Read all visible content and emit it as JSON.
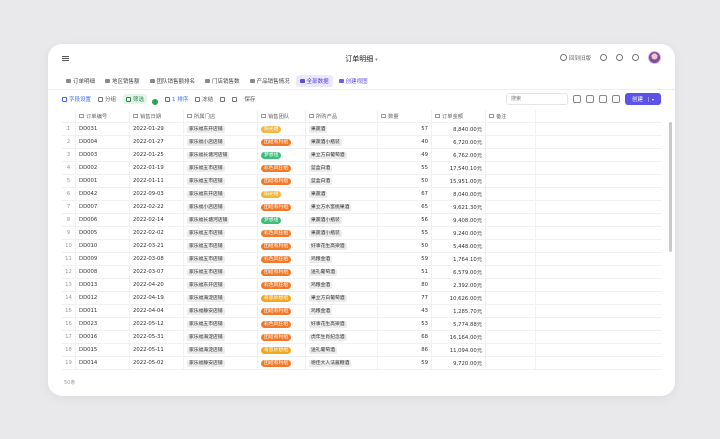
{
  "app": {
    "title": "订单明细"
  },
  "top_actions": {
    "reply_label": "回到旧版"
  },
  "tabs": [
    {
      "label": "订单明细"
    },
    {
      "label": "地区销售额"
    },
    {
      "label": "团队销售额排名"
    },
    {
      "label": "门店销售数"
    },
    {
      "label": "产品销售情况"
    },
    {
      "label": "全部数据",
      "active": true
    },
    {
      "label": "创建视图",
      "purple": true
    }
  ],
  "toolbar": {
    "fields": "字段设置",
    "group": "分组",
    "filter": "筛选",
    "sort": "1 排序",
    "fill": "冻结",
    "save": "保存",
    "search_placeholder": "搜索",
    "create": "创建"
  },
  "columns": [
    "订单编号",
    "销售日期",
    "所属门店",
    "销售团队",
    "所购产品",
    "数量",
    "订单金额",
    "备注"
  ],
  "colors": {
    "团结有利观": "#f07a2c",
    "阳光組": "#f3b63a",
    "梦想组": "#3ebd79",
    "彩色风狂组": "#ef9b3a",
    "奇思妙想组": "#f2b21e"
  },
  "rows": [
    {
      "idx": "1",
      "id": "DD031",
      "date": "2022-01-29",
      "store": "家乐福东开店铺",
      "team": "阳光组",
      "team_color": "#f3b63a",
      "product": "果蔬酒",
      "qty": "57",
      "amount": "8,840.00元"
    },
    {
      "idx": "2",
      "id": "DD004",
      "date": "2022-01-27",
      "store": "家乐福小店店铺",
      "team": "团结有利组",
      "team_color": "#f07a2c",
      "product": "果蔬酒小瓶装",
      "qty": "40",
      "amount": "6,720.00元"
    },
    {
      "idx": "3",
      "id": "DD003",
      "date": "2022-01-25",
      "store": "家乐福长塘河店铺",
      "team": "梦想组",
      "team_color": "#3ebd79",
      "product": "果立方白葡萄酒",
      "qty": "49",
      "amount": "6,762.00元"
    },
    {
      "idx": "4",
      "id": "DD002",
      "date": "2022-01-19",
      "store": "家乐福五市店铺",
      "team": "彩色风狂组",
      "team_color": "#ef7b2b",
      "product": "蓝盒白酒",
      "qty": "55",
      "amount": "17,540.10元"
    },
    {
      "idx": "5",
      "id": "DD001",
      "date": "2022-01-11",
      "store": "家乐福五市店铺",
      "team": "团结有利组",
      "team_color": "#f07a2c",
      "product": "蓝盒白酒",
      "qty": "50",
      "amount": "15,951.00元"
    },
    {
      "idx": "6",
      "id": "DD042",
      "date": "2022-09-03",
      "store": "家乐福东开店铺",
      "team": "阳光组",
      "team_color": "#f3b63a",
      "product": "果蔬酒",
      "qty": "67",
      "amount": "8,040.00元"
    },
    {
      "idx": "7",
      "id": "DD007",
      "date": "2022-02-22",
      "store": "家乐福小店店铺",
      "team": "团结有利组",
      "team_color": "#f07a2c",
      "product": "果立方水蜜桃果酒",
      "qty": "65",
      "amount": "9,621.30元"
    },
    {
      "idx": "8",
      "id": "DD006",
      "date": "2022-02-14",
      "store": "家乐福长塘河店铺",
      "team": "梦想组",
      "team_color": "#3ebd79",
      "product": "果蔬酒小瓶装",
      "qty": "56",
      "amount": "9,408.00元"
    },
    {
      "idx": "9",
      "id": "DD005",
      "date": "2022-02-02",
      "store": "家乐福五市店铺",
      "team": "彩色风狂组",
      "team_color": "#ef7b2b",
      "product": "果蔬酒小瓶装",
      "qty": "55",
      "amount": "9,240.00元"
    },
    {
      "idx": "10",
      "id": "DD010",
      "date": "2022-03-21",
      "store": "家乐福五市店铺",
      "team": "团结有利组",
      "team_color": "#f07a2c",
      "product": "好事花生高梁酒",
      "qty": "50",
      "amount": "5,448.00元"
    },
    {
      "idx": "11",
      "id": "DD009",
      "date": "2022-03-08",
      "store": "家乐福五市店铺",
      "team": "彩色风狂组",
      "team_color": "#ef7b2b",
      "product": "鸡粮金酒",
      "qty": "59",
      "amount": "1,764.10元"
    },
    {
      "idx": "12",
      "id": "DD008",
      "date": "2022-03-07",
      "store": "家乐福五市店铺",
      "team": "团结有利组",
      "team_color": "#f07a2c",
      "product": "送礼葡萄酒",
      "qty": "51",
      "amount": "6,579.00元"
    },
    {
      "idx": "13",
      "id": "DD013",
      "date": "2022-04-20",
      "store": "家乐福东开店铺",
      "team": "彩色风狂组",
      "team_color": "#ef7b2b",
      "product": "鸡粮金酒",
      "qty": "80",
      "amount": "2,392.00元"
    },
    {
      "idx": "14",
      "id": "DD012",
      "date": "2022-04-19",
      "store": "家乐福海淀店铺",
      "team": "奇思妙想组",
      "team_color": "#f2a81e",
      "product": "果立方白葡萄酒",
      "qty": "77",
      "amount": "10,626.00元"
    },
    {
      "idx": "15",
      "id": "DD011",
      "date": "2022-04-04",
      "store": "家乐福静安店铺",
      "team": "团结有利组",
      "team_color": "#f07a2c",
      "product": "鸡粮金酒",
      "qty": "43",
      "amount": "1,285.70元"
    },
    {
      "idx": "16",
      "id": "DD023",
      "date": "2022-05-12",
      "store": "家乐福五市店铺",
      "team": "彩色风狂组",
      "team_color": "#ef7b2b",
      "product": "好事花生高梁酒",
      "qty": "53",
      "amount": "5,774.88元"
    },
    {
      "idx": "17",
      "id": "DD016",
      "date": "2022-05-31",
      "store": "家乐福海淀店铺",
      "team": "团结有利组",
      "team_color": "#f07a2c",
      "product": "虎年生肖纪念酒",
      "qty": "68",
      "amount": "16,164.00元"
    },
    {
      "idx": "18",
      "id": "DD015",
      "date": "2022-05-11",
      "store": "家乐福海淀店铺",
      "team": "奇思妙想组",
      "team_color": "#f2a81e",
      "product": "送礼葡萄酒",
      "qty": "86",
      "amount": "11,094.00元"
    },
    {
      "idx": "19",
      "id": "DD014",
      "date": "2022-05-02",
      "store": "家乐福静安店铺",
      "team": "团结有利组",
      "team_color": "#f07a2c",
      "product": "德佳大人法酱糖酒",
      "qty": "59",
      "amount": "9,720.00元"
    }
  ],
  "footer": {
    "count": "50条"
  }
}
